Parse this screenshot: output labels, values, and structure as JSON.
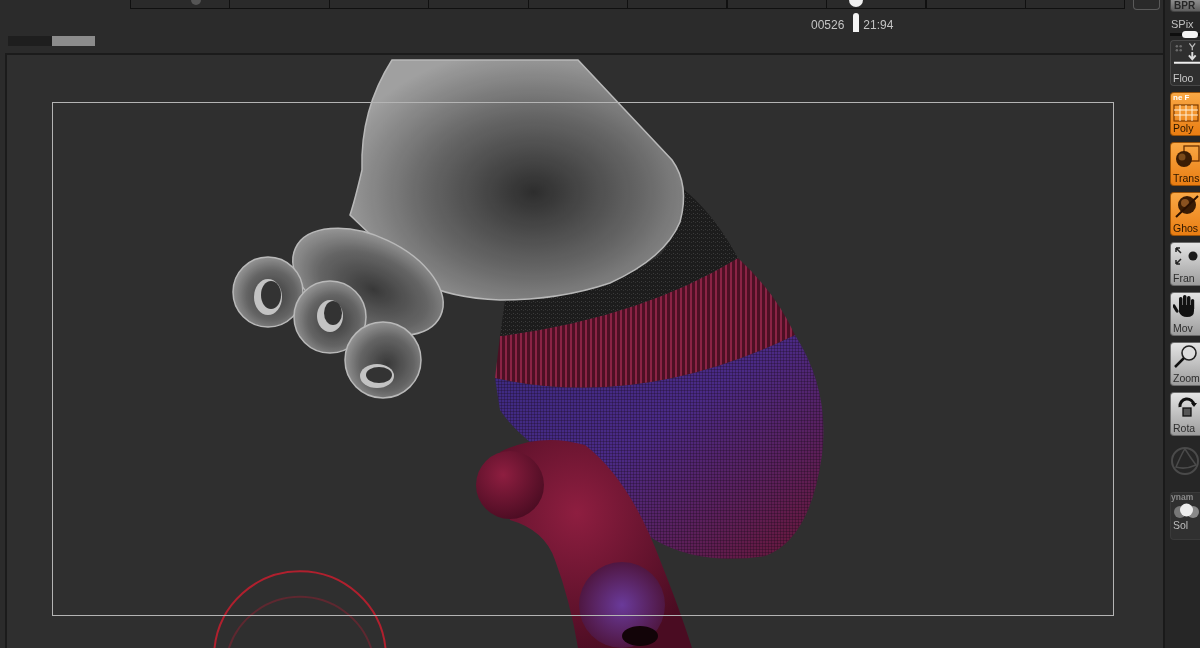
{
  "timeline": {
    "level": 0.73,
    "frame": "00526",
    "time": "21:94"
  },
  "render_button": {
    "label": "BPR"
  },
  "spix": {
    "label": "SPix",
    "level": 0.65
  },
  "shelf": [
    {
      "kind": "toggle",
      "label": "Floo",
      "on": false
    },
    {
      "kind": "toggle",
      "label": "Poly",
      "on": true,
      "overlay": "ne F"
    },
    {
      "kind": "toggle",
      "label": "Trans",
      "on": true
    },
    {
      "kind": "toggle",
      "label": "Ghos",
      "on": true
    },
    {
      "kind": "action",
      "label": "Fran"
    },
    {
      "kind": "action",
      "label": "Mov"
    },
    {
      "kind": "action",
      "label": "Zoom"
    },
    {
      "kind": "action",
      "label": "Rota"
    },
    {
      "kind": "icon",
      "disabled": true
    }
  ],
  "dynamics": {
    "label": "ynam",
    "solo": {
      "label": "Sol"
    }
  }
}
